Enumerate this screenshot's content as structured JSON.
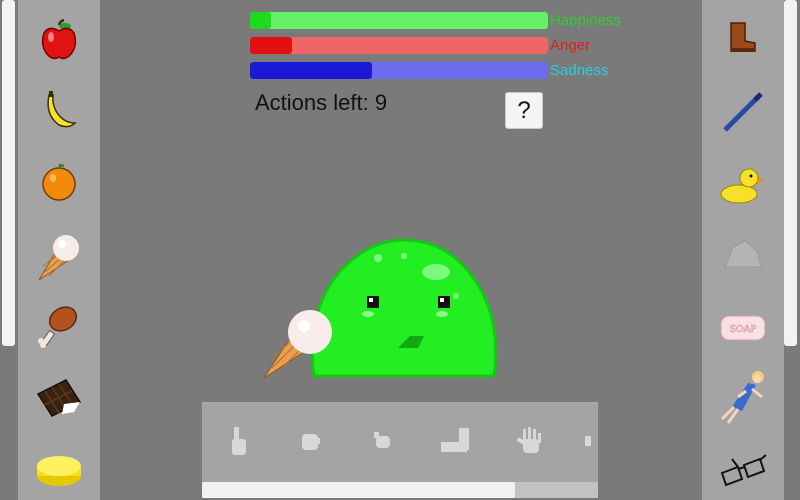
{
  "meters": [
    {
      "label": "Happiness",
      "level": 0.07,
      "fill_color": "#1edb1e",
      "track_color": "#66ee66",
      "label_color": "#2ecc2e"
    },
    {
      "label": "Anger",
      "level": 0.14,
      "fill_color": "#e31010",
      "track_color": "#ee6666",
      "label_color": "#dd2222"
    },
    {
      "label": "Sadness",
      "level": 0.41,
      "fill_color": "#1a1ad6",
      "track_color": "#6c6cee",
      "label_color": "#22d0e6"
    }
  ],
  "actions_label": "Actions left: 9",
  "help_label": "?",
  "left_items": [
    "apple-icon",
    "banana-icon",
    "orange-icon",
    "ice-cream-icon",
    "chicken-drumstick-icon",
    "chocolate-bar-icon",
    "cheese-icon"
  ],
  "right_items": [
    "boot-icon",
    "pen-icon",
    "rubber-duck-icon",
    "rock-icon",
    "soap-icon",
    "doll-icon",
    "glasses-icon"
  ],
  "soap_text": "SOAP",
  "interaction_hands": [
    "pointing-hand-icon",
    "grab-hand-icon",
    "pinch-hand-icon",
    "flat-hand-icon",
    "open-hand-icon",
    "partial-hand-icon"
  ],
  "slime_color": "#22ee22",
  "held_item": "ice-cream-icon",
  "tray_scroll_position": 0.79
}
